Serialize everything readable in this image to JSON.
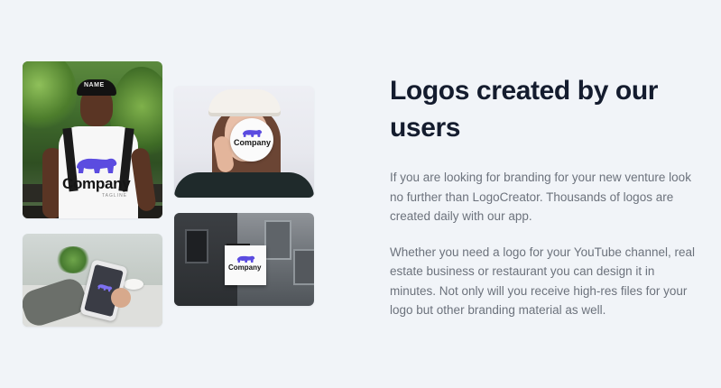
{
  "section": {
    "heading": "Logos created by our users",
    "paragraph_1": "If you are looking for branding for your new venture look no further than LogoCreator. Thousands of logos are created daily with our app.",
    "paragraph_2": "Whether you need a logo for your YouTube channel, real estate business or restaurant you can design it in minutes. Not only will you receive high-res files for your logo but other branding material as well."
  },
  "gallery": {
    "photo_1": {
      "cap_text": "NAME",
      "brand": "Company",
      "tagline": "TAGLINE"
    },
    "photo_2": {
      "brand": "Company"
    },
    "photo_3": {},
    "photo_4": {
      "brand": "Company"
    }
  },
  "colors": {
    "background": "#f1f4f8",
    "heading": "#141c2e",
    "body_text": "#6c727c",
    "logo_accent": "#5b4ce0"
  }
}
